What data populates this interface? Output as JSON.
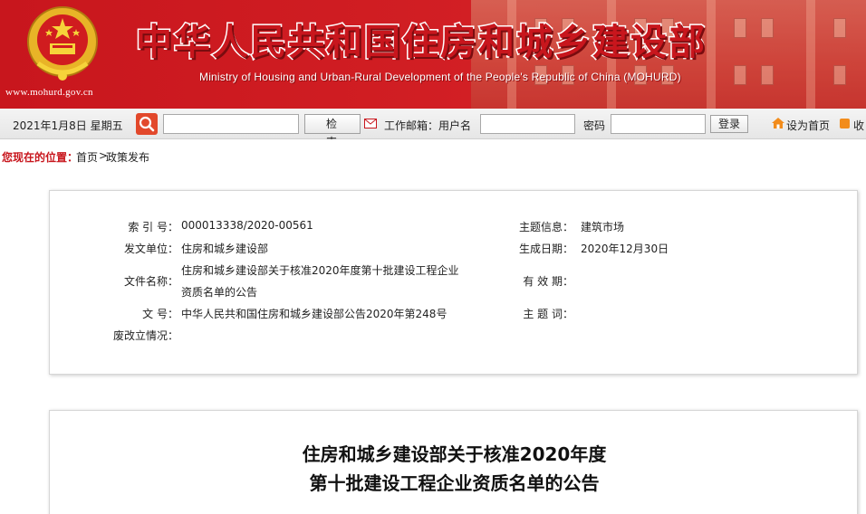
{
  "banner": {
    "title": "中华人民共和国住房和城乡建设部",
    "subtitle": "Ministry of Housing and Urban-Rural Development of the People's Republic of China (MOHURD)",
    "url": "www.mohurd.gov.cn"
  },
  "toolbar": {
    "date": "2021年1月8日  星期五",
    "search_placeholder": "",
    "search_button": "检 索",
    "mail_label": "工作邮箱：用户名",
    "password_label": "密码",
    "login_button": "登录",
    "set_home": "设为首页",
    "favorite": "收"
  },
  "breadcrumb": {
    "label": "您现在的位置：",
    "home": "首页",
    "separator": ">",
    "current": "政策发布"
  },
  "info": {
    "index_key": "索 引 号：",
    "index_val": "000013338/2020-00561",
    "theme_key": "主题信息：",
    "theme_val": "建筑市场",
    "issuer_key": "发文单位：",
    "issuer_val": "住房和城乡建设部",
    "date_key": "生成日期：",
    "date_val": "2020年12月30日",
    "docname_key": "文件名称：",
    "docname_line1": "住房和城乡建设部关于核准2020年度第十批建设工程企业",
    "docname_line2": "资质名单的公告",
    "validity_key": "有 效 期：",
    "docno_key": "文        号：",
    "docno_val": "中华人民共和国住房和城乡建设部公告2020年第248号",
    "subject_key": "主 题 词：",
    "status_key": "废改立情况："
  },
  "article": {
    "title_line1": "住房和城乡建设部关于核准2020年度",
    "title_line2": "第十批建设工程企业资质名单的公告"
  },
  "colors": {
    "brand_red": "#c8161d",
    "toolbar_bg": "#e6e6e6"
  }
}
